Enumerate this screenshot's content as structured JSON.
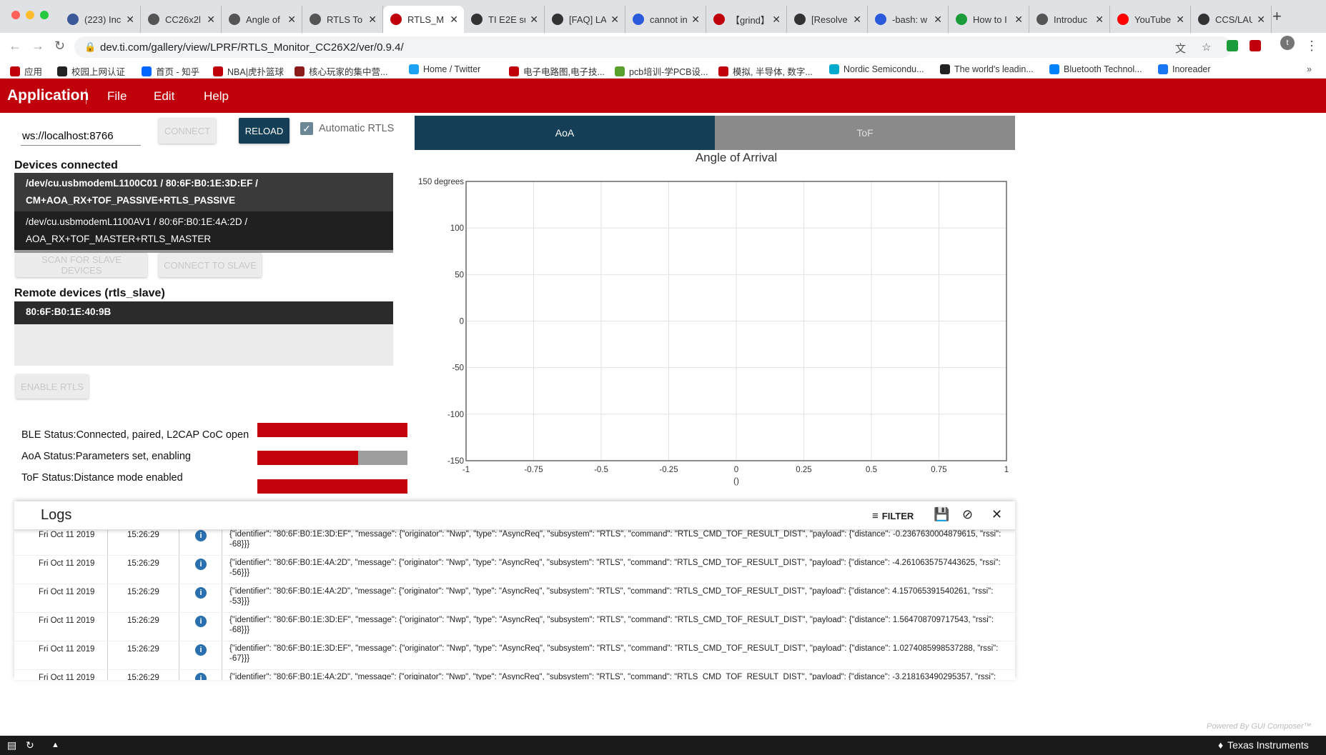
{
  "browser": {
    "tabs": [
      {
        "title": "(223) Inc",
        "icon_color": "#3b5998",
        "active": false
      },
      {
        "title": "CC26x2l",
        "icon_color": "#555555",
        "active": false
      },
      {
        "title": "Angle of",
        "icon_color": "#555555",
        "active": false
      },
      {
        "title": "RTLS To",
        "icon_color": "#555555",
        "active": false
      },
      {
        "title": "RTLS_M",
        "icon_color": "#c0000a",
        "active": true
      },
      {
        "title": "TI E2E su",
        "icon_color": "#333333",
        "active": false
      },
      {
        "title": "[FAQ] LA",
        "icon_color": "#333333",
        "active": false
      },
      {
        "title": "cannot in",
        "icon_color": "#2b5bdc",
        "active": false
      },
      {
        "title": "【grind】",
        "icon_color": "#c0000a",
        "active": false
      },
      {
        "title": "[Resolve",
        "icon_color": "#333333",
        "active": false
      },
      {
        "title": "-bash: w",
        "icon_color": "#2b5bdc",
        "active": false
      },
      {
        "title": "How to I",
        "icon_color": "#1a9c3a",
        "active": false
      },
      {
        "title": "Introduc",
        "icon_color": "#555555",
        "active": false
      },
      {
        "title": "YouTube",
        "icon_color": "#ff0000",
        "active": false
      },
      {
        "title": "CCS/LAU",
        "icon_color": "#333333",
        "active": false
      }
    ],
    "url": "dev.ti.com/gallery/view/LPRF/RTLS_Monitor_CC26X2/ver/0.9.4/",
    "profile_initial": "t",
    "bookmarks": [
      {
        "label": "应用",
        "color": "#c0000a"
      },
      {
        "label": "校园上网认证",
        "color": "#222222"
      },
      {
        "label": "首页 - 知乎",
        "color": "#0066ff"
      },
      {
        "label": "NBA|虎扑篮球",
        "color": "#c0000a"
      },
      {
        "label": "核心玩家的集中营...",
        "color": "#8b1a1a"
      },
      {
        "label": "Home / Twitter",
        "color": "#1da1f2"
      },
      {
        "label": "电子电路图,电子技...",
        "color": "#c0000a"
      },
      {
        "label": "pcb培训-学PCB设...",
        "color": "#5aa02c"
      },
      {
        "label": "模拟, 半导体, 数字...",
        "color": "#c0000a"
      },
      {
        "label": "Nordic Semicondu...",
        "color": "#00a9ce"
      },
      {
        "label": "The world's leadin...",
        "color": "#222222"
      },
      {
        "label": "Bluetooth Technol...",
        "color": "#0082fc"
      },
      {
        "label": "Inoreader",
        "color": "#1875f3"
      }
    ]
  },
  "app": {
    "title": "Application",
    "menu": [
      "File",
      "Edit",
      "Help"
    ],
    "ws_url": "ws://localhost:8766",
    "connect_label": "CONNECT",
    "reload_label": "RELOAD",
    "auto_rtls_label": "Automatic RTLS",
    "devices_title": "Devices connected",
    "devices": [
      {
        "line1": "/dev/cu.usbmodemL1100C01 / 80:6F:B0:1E:3D:EF /",
        "line2": "CM+AOA_RX+TOF_PASSIVE+RTLS_PASSIVE"
      },
      {
        "line1": "/dev/cu.usbmodemL1100AV1 / 80:6F:B0:1E:4A:2D /",
        "line2": "AOA_RX+TOF_MASTER+RTLS_MASTER"
      }
    ],
    "scan_label": "SCAN FOR SLAVE DEVICES",
    "connect_slave_label": "CONNECT TO SLAVE",
    "remote_title": "Remote devices (rtls_slave)",
    "remote_device": "80:6F:B0:1E:40:9B",
    "enable_rtls_label": "ENABLE RTLS",
    "status": [
      {
        "label": "BLE Status:Connected, paired, L2CAP CoC open",
        "progress": 1.0
      },
      {
        "label": "AoA Status:Parameters set, enabling",
        "progress": 0.67
      },
      {
        "label": "ToF Status:Distance mode enabled",
        "progress": 1.0
      }
    ]
  },
  "chart_tabs": {
    "aoa": "AoA",
    "tof": "ToF"
  },
  "chart_data": {
    "type": "scatter",
    "title": "Angle of Arrival",
    "xlabel": "()",
    "ylabel": "",
    "x_ticks": [
      -1,
      -0.75,
      -0.5,
      -0.25,
      0,
      0.25,
      0.5,
      0.75,
      1
    ],
    "y_ticks": [
      -150,
      -100,
      -50,
      0,
      50,
      100,
      150
    ],
    "y_tick_labels": [
      "-150",
      "-100",
      "-50",
      "0",
      "50",
      "100",
      "150 degrees"
    ],
    "xlim": [
      -1,
      1
    ],
    "ylim": [
      -150,
      150
    ],
    "grid": true,
    "series": []
  },
  "logs": {
    "title": "Logs",
    "filter_label": "FILTER",
    "rows": [
      {
        "date": "Fri Oct 11 2019",
        "time": "15:26:29",
        "msg1": "{\"identifier\": \"80:6F:B0:1E:3D:EF\", \"message\": {\"originator\": \"Nwp\", \"type\": \"AsyncReq\", \"subsystem\": \"RTLS\", \"command\": \"RTLS_CMD_TOF_RESULT_DIST\", \"payload\": {\"distance\": -0.2367630004879615, \"rssi\":",
        "msg2": "-68}}}"
      },
      {
        "date": "Fri Oct 11 2019",
        "time": "15:26:29",
        "msg1": "{\"identifier\": \"80:6F:B0:1E:4A:2D\", \"message\": {\"originator\": \"Nwp\", \"type\": \"AsyncReq\", \"subsystem\": \"RTLS\", \"command\": \"RTLS_CMD_TOF_RESULT_DIST\", \"payload\": {\"distance\": -4.2610635757443625, \"rssi\":",
        "msg2": "-56}}}"
      },
      {
        "date": "Fri Oct 11 2019",
        "time": "15:26:29",
        "msg1": "{\"identifier\": \"80:6F:B0:1E:4A:2D\", \"message\": {\"originator\": \"Nwp\", \"type\": \"AsyncReq\", \"subsystem\": \"RTLS\", \"command\": \"RTLS_CMD_TOF_RESULT_DIST\", \"payload\": {\"distance\": 4.157065391540261, \"rssi\":",
        "msg2": "-53}}}"
      },
      {
        "date": "Fri Oct 11 2019",
        "time": "15:26:29",
        "msg1": "{\"identifier\": \"80:6F:B0:1E:3D:EF\", \"message\": {\"originator\": \"Nwp\", \"type\": \"AsyncReq\", \"subsystem\": \"RTLS\", \"command\": \"RTLS_CMD_TOF_RESULT_DIST\", \"payload\": {\"distance\": 1.564708709717543, \"rssi\":",
        "msg2": "-68}}}"
      },
      {
        "date": "Fri Oct 11 2019",
        "time": "15:26:29",
        "msg1": "{\"identifier\": \"80:6F:B0:1E:3D:EF\", \"message\": {\"originator\": \"Nwp\", \"type\": \"AsyncReq\", \"subsystem\": \"RTLS\", \"command\": \"RTLS_CMD_TOF_RESULT_DIST\", \"payload\": {\"distance\": 1.0274085998537288, \"rssi\":",
        "msg2": "-67}}}"
      },
      {
        "date": "Fri Oct 11 2019",
        "time": "15:26:29",
        "msg1": "{\"identifier\": \"80:6F:B0:1E:4A:2D\", \"message\": {\"originator\": \"Nwp\", \"type\": \"AsyncReq\", \"subsystem\": \"RTLS\", \"command\": \"RTLS_CMD_TOF_RESULT_DIST\", \"payload\": {\"distance\": -3.218163490295357, \"rssi\":",
        "msg2": ""
      }
    ]
  },
  "footer": {
    "powered": "Powered By GUI Composer™",
    "brand": "Texas Instruments"
  },
  "colors": {
    "brand_red": "#c0000a",
    "primary_dark": "#153f56",
    "info_blue": "#2a6fb0"
  }
}
